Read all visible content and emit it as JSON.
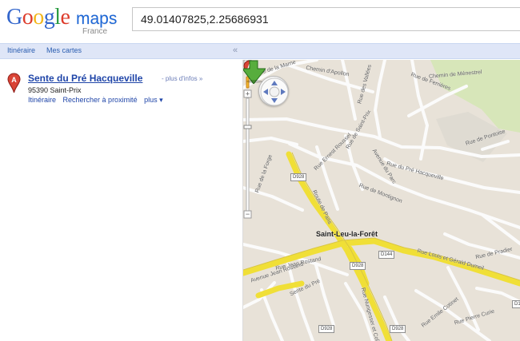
{
  "header": {
    "logo_letters": [
      "G",
      "o",
      "o",
      "g",
      "l",
      "e"
    ],
    "logo_maps": "maps",
    "logo_country": "France",
    "search_query": "49.01407825,2.25686931"
  },
  "topbar": {
    "itinerary": "Itinéraire",
    "my_maps": "Mes cartes",
    "collapse": "«"
  },
  "sidebar": {
    "result": {
      "marker_letter": "A",
      "title": "Sente du Pré Hacqueville",
      "more_info": "- plus d'infos »",
      "address": "95390 Saint-Prix",
      "actions": [
        "Itinéraire",
        "Rechercher à proximité",
        "plus ▾"
      ]
    }
  },
  "map": {
    "marker_letter": "A",
    "labels": [
      "Rue de la Marne",
      "Chemin d'Apollon",
      "Rue des Vallées",
      "Rue de Ferrières",
      "Chemin de Ménestrel",
      "Rue de Saint-Prix",
      "Rue Ernest Roussel",
      "Avenue du Parc",
      "Rue de la Forge",
      "Route de Paris",
      "Rue de Montignon",
      "Rue du Pré Hacqueville",
      "Rue Jean Rostand",
      "Avenue Jean Rostand",
      "Sente du Pré",
      "Saint-Leu-la-Forêt",
      "Rue Louis et Gérald Dumeil",
      "Rue Nungesser et Coli",
      "Rue Pierre Curie",
      "Rue de Pontoise",
      "Rue Emile Cotinet",
      "Rue de Pradier"
    ],
    "road_badges": [
      "D928",
      "D928",
      "D928",
      "D144",
      "D928",
      "D1"
    ],
    "zoom_controls": [
      "+",
      "−"
    ]
  },
  "colors": {
    "blue": "#1f45a8",
    "google_blue": "#3366cc",
    "google_red": "#dd3b2b",
    "google_yellow": "#f2b61b",
    "google_green": "#2c9c43",
    "map_background": "#e8e2d8",
    "main_road": "#f4e33b",
    "green_area": "#d7e6b9"
  }
}
